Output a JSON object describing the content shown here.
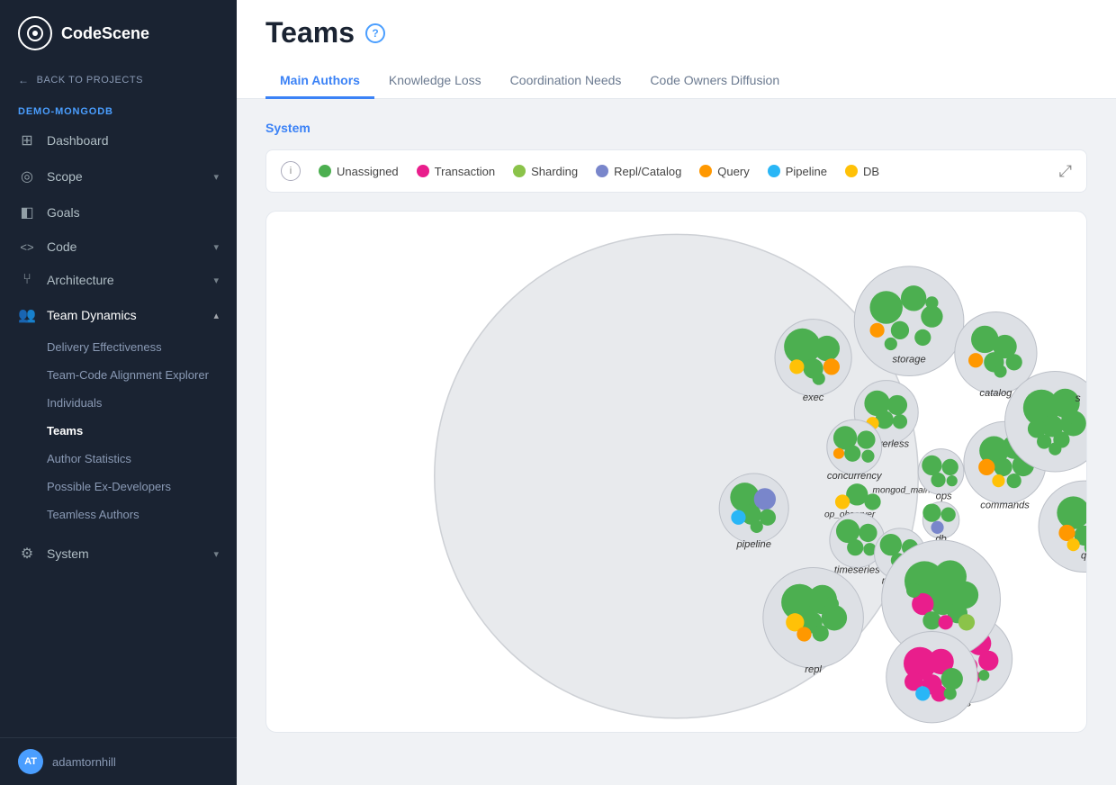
{
  "sidebar": {
    "logo_text": "CodeScene",
    "back_label": "BACK TO PROJECTS",
    "project_label": "DEMO-MONGODB",
    "nav_items": [
      {
        "id": "dashboard",
        "label": "Dashboard",
        "icon": "⊞",
        "has_arrow": false
      },
      {
        "id": "scope",
        "label": "Scope",
        "icon": "◎",
        "has_arrow": true
      },
      {
        "id": "goals",
        "label": "Goals",
        "icon": "⊡",
        "has_arrow": false
      },
      {
        "id": "code",
        "label": "Code",
        "icon": "<>",
        "has_arrow": true
      },
      {
        "id": "architecture",
        "label": "Architecture",
        "icon": "⑂",
        "has_arrow": true
      },
      {
        "id": "team_dynamics",
        "label": "Team Dynamics",
        "icon": "👥",
        "has_arrow": true,
        "active": true
      },
      {
        "id": "system",
        "label": "System",
        "icon": "⚙",
        "has_arrow": true
      }
    ],
    "sub_nav": [
      {
        "id": "delivery_effectiveness",
        "label": "Delivery Effectiveness"
      },
      {
        "id": "team_code_alignment",
        "label": "Team-Code Alignment Explorer"
      },
      {
        "id": "individuals",
        "label": "Individuals"
      },
      {
        "id": "teams",
        "label": "Teams",
        "active": true
      },
      {
        "id": "author_statistics",
        "label": "Author Statistics"
      },
      {
        "id": "possible_ex_developers",
        "label": "Possible Ex-Developers"
      },
      {
        "id": "teamless_authors",
        "label": "Teamless Authors"
      }
    ],
    "user": "adamtornhill"
  },
  "page": {
    "title": "Teams",
    "help_icon": "?",
    "tabs": [
      {
        "id": "main_authors",
        "label": "Main Authors",
        "active": true
      },
      {
        "id": "knowledge_loss",
        "label": "Knowledge Loss"
      },
      {
        "id": "coordination_needs",
        "label": "Coordination Needs"
      },
      {
        "id": "code_owners_diffusion",
        "label": "Code Owners Diffusion"
      }
    ],
    "system_label": "System"
  },
  "legend": {
    "items": [
      {
        "id": "unassigned",
        "label": "Unassigned",
        "color": "#4caf50"
      },
      {
        "id": "transaction",
        "label": "Transaction",
        "color": "#e91e8c"
      },
      {
        "id": "sharding",
        "label": "Sharding",
        "color": "#8bc34a"
      },
      {
        "id": "repl_catalog",
        "label": "Repl/Catalog",
        "color": "#7986cb"
      },
      {
        "id": "query",
        "label": "Query",
        "color": "#ff9800"
      },
      {
        "id": "pipeline",
        "label": "Pipeline",
        "color": "#29b6f6"
      },
      {
        "id": "db",
        "label": "DB",
        "color": "#ffc107"
      }
    ]
  },
  "colors": {
    "green": "#4caf50",
    "pink": "#e91e8c",
    "olive": "#8bc34a",
    "blue_purple": "#7986cb",
    "orange": "#ff9800",
    "light_blue": "#29b6f6",
    "yellow": "#ffc107",
    "teal": "#009688",
    "red": "#f44336"
  }
}
